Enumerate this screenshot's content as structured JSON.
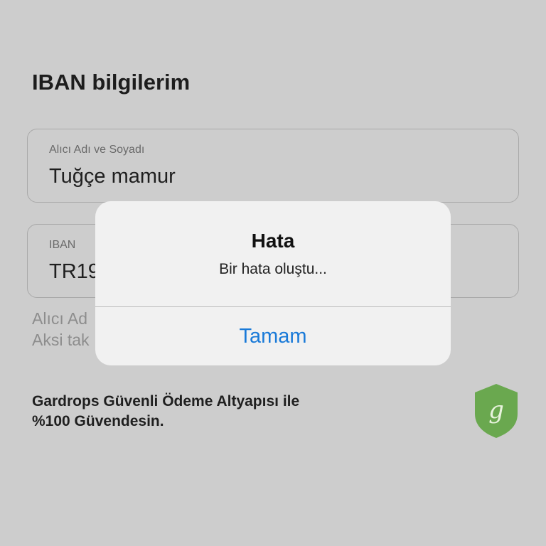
{
  "header": {
    "title": "IBAN bilgilerim"
  },
  "form": {
    "name_field": {
      "label": "Alıcı Adı ve Soyadı",
      "value": "Tuğçe mamur"
    },
    "iban_field": {
      "label": "IBAN",
      "value": "TR19"
    },
    "helper_line1": "Alıcı Ad",
    "helper_line2": "Aksi tak"
  },
  "footer": {
    "secure_line1": "Gardrops Güvenli Ödeme Altyapısı ile",
    "secure_line2": "%100 Güvendesin.",
    "shield_letter": "g",
    "shield_color": "#6aa84f",
    "shield_icon": "shield-icon"
  },
  "alert": {
    "title": "Hata",
    "message": "Bir hata oluştu...",
    "button_label": "Tamam",
    "button_color": "#1a7ad8"
  }
}
